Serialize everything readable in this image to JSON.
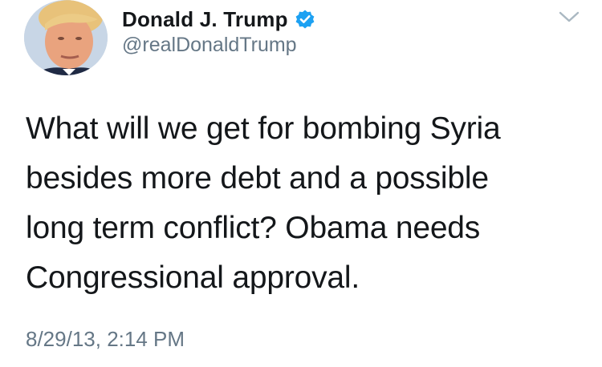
{
  "user": {
    "display_name": "Donald J. Trump",
    "handle": "@realDonaldTrump",
    "verified": true,
    "avatar_icon": "profile-photo",
    "verified_icon": "verified-badge-icon",
    "verified_color": "#1da1f2"
  },
  "tweet": {
    "lines": [
      "What will we get for bombing Syria",
      "besides more debt and a possible",
      "long term conflict? Obama needs",
      "Congressional approval."
    ],
    "timestamp": "8/29/13, 2:14 PM"
  },
  "menu": {
    "icon": "chevron-down-icon"
  },
  "colors": {
    "text": "#14171a",
    "secondary": "#657786",
    "background": "#ffffff"
  }
}
